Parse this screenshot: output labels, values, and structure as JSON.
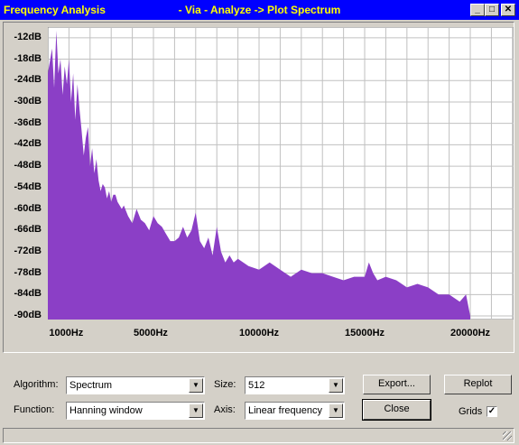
{
  "window": {
    "title_left": "Frequency Analysis",
    "title_center": "- Via - Analyze -> Plot Spectrum",
    "minimize_glyph": "_",
    "maximize_glyph": "□",
    "close_glyph": "✕"
  },
  "chart_data": {
    "type": "area",
    "color": "#8b3fc6",
    "ylabels": [
      "-12dB",
      "-18dB",
      "-24dB",
      "-30dB",
      "-36dB",
      "-42dB",
      "-48dB",
      "-54dB",
      "-60dB",
      "-66dB",
      "-72dB",
      "-78dB",
      "-84dB",
      "-90dB"
    ],
    "xlabels": [
      "1000Hz",
      "5000Hz",
      "10000Hz",
      "15000Hz",
      "20000Hz"
    ],
    "xlim": [
      0,
      22050
    ],
    "ylim": [
      -91,
      -9
    ],
    "grid": true,
    "x": [
      0,
      200,
      300,
      400,
      500,
      600,
      700,
      800,
      900,
      1000,
      1100,
      1200,
      1300,
      1400,
      1500,
      1600,
      1700,
      1800,
      1900,
      2000,
      2100,
      2200,
      2300,
      2400,
      2500,
      2600,
      2700,
      2800,
      2900,
      3000,
      3100,
      3200,
      3300,
      3400,
      3500,
      3600,
      3800,
      4000,
      4200,
      4400,
      4600,
      4800,
      5000,
      5200,
      5400,
      5600,
      5800,
      6000,
      6200,
      6400,
      6600,
      6800,
      7000,
      7200,
      7400,
      7600,
      7800,
      8000,
      8200,
      8400,
      8600,
      8800,
      9000,
      9500,
      10000,
      10500,
      11000,
      11500,
      12000,
      12500,
      13000,
      13500,
      14000,
      14500,
      15000,
      15200,
      15400,
      15600,
      16000,
      16500,
      17000,
      17500,
      18000,
      18500,
      19000,
      19500,
      19800,
      20000
    ],
    "y": [
      -22,
      -15,
      -26,
      -10,
      -22,
      -18,
      -28,
      -20,
      -25,
      -18,
      -30,
      -22,
      -35,
      -25,
      -32,
      -38,
      -45,
      -40,
      -37,
      -48,
      -43,
      -50,
      -46,
      -52,
      -55,
      -53,
      -54,
      -57,
      -55,
      -58,
      -56,
      -56,
      -58,
      -59,
      -60,
      -59,
      -62,
      -64,
      -60,
      -63,
      -64,
      -66,
      -62,
      -64,
      -65,
      -67,
      -69,
      -69,
      -68,
      -65,
      -68,
      -66,
      -61,
      -69,
      -71,
      -68,
      -73,
      -65,
      -72,
      -75,
      -73,
      -75,
      -74,
      -76,
      -77,
      -75,
      -77,
      -79,
      -77,
      -78,
      -78,
      -79,
      -80,
      -79,
      -79,
      -75,
      -78,
      -80,
      -79,
      -80,
      -82,
      -81,
      -82,
      -84,
      -84,
      -86,
      -84,
      -90
    ]
  },
  "controls": {
    "algorithm_label": "Algorithm:",
    "algorithm_value": "Spectrum",
    "function_label": "Function:",
    "function_value": "Hanning window",
    "size_label": "Size:",
    "size_value": "512",
    "axis_label": "Axis:",
    "axis_value": "Linear frequency",
    "export_label": "Export...",
    "replot_label": "Replot",
    "close_label": "Close",
    "grids_label": "Grids",
    "grids_checked": "✓",
    "dropdown_arrow": "▼"
  }
}
